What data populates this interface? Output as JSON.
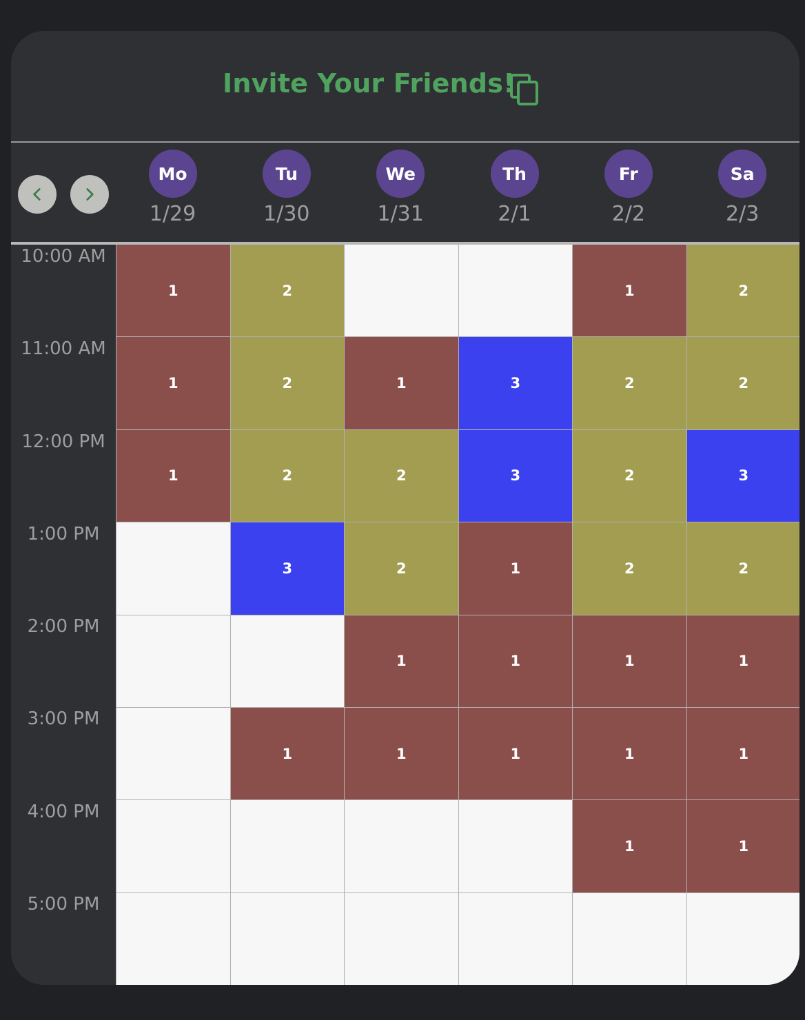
{
  "header": {
    "title": "Invite Your Friends!",
    "copy_icon": "copy-icon"
  },
  "nav": {
    "prev_icon": "chevron-left-icon",
    "next_icon": "chevron-right-icon"
  },
  "days": [
    {
      "abbr": "Mo",
      "date": "1/29"
    },
    {
      "abbr": "Tu",
      "date": "1/30"
    },
    {
      "abbr": "We",
      "date": "1/31"
    },
    {
      "abbr": "Th",
      "date": "2/1"
    },
    {
      "abbr": "Fr",
      "date": "2/2"
    },
    {
      "abbr": "Sa",
      "date": "2/3"
    }
  ],
  "times": [
    "10:00 AM",
    "11:00 AM",
    "12:00 PM",
    "1:00 PM",
    "2:00 PM",
    "3:00 PM",
    "4:00 PM",
    "5:00 PM"
  ],
  "counts": [
    [
      1,
      2,
      0,
      0,
      1,
      2
    ],
    [
      1,
      2,
      1,
      3,
      2,
      2
    ],
    [
      1,
      2,
      2,
      3,
      2,
      3
    ],
    [
      0,
      3,
      2,
      1,
      2,
      2
    ],
    [
      0,
      0,
      1,
      1,
      1,
      1
    ],
    [
      0,
      1,
      1,
      1,
      1,
      1
    ],
    [
      0,
      0,
      0,
      0,
      1,
      1
    ],
    [
      0,
      0,
      0,
      0,
      0,
      0
    ]
  ],
  "colors": {
    "empty": "#f7f7f7",
    "one": "#8b4f4b",
    "two": "#a29d50",
    "three": "#3b41ef",
    "title": "#4fa35f",
    "day_pill": "#5c4590"
  }
}
